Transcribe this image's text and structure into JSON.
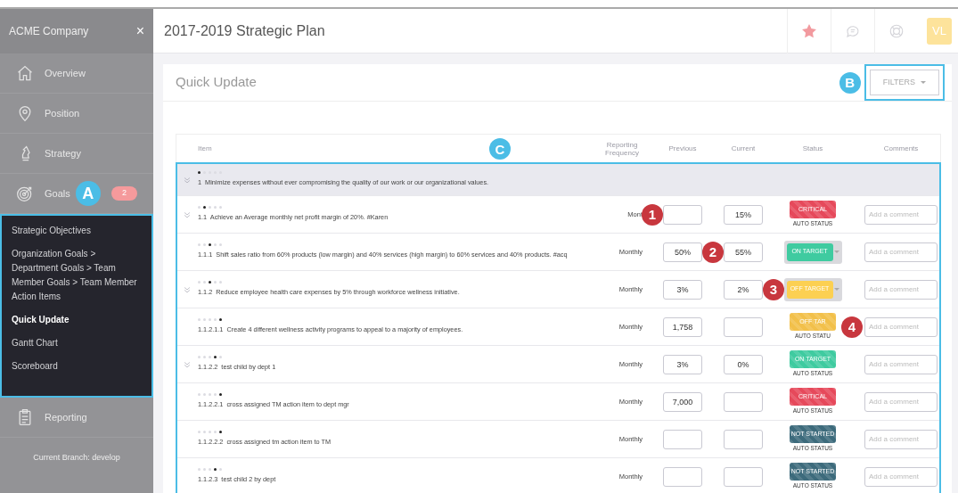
{
  "sidebar": {
    "company": "ACME Company",
    "close": "×",
    "items": [
      {
        "label": "Overview",
        "kind": "home"
      },
      {
        "label": "Position",
        "kind": "pin"
      },
      {
        "label": "Strategy",
        "kind": "pawn"
      },
      {
        "label": "Goals",
        "kind": "target",
        "badge": "2",
        "expanded": true,
        "callout": {
          "label": "A",
          "color": "#4bbde6"
        },
        "children": [
          {
            "label": "Strategic Objectives",
            "selected": false
          },
          {
            "label": "Organization Goals > Department Goals > Team Member Goals > Team Member Action Items",
            "selected": false
          },
          {
            "label": "Quick Update",
            "selected": true
          },
          {
            "label": "Gantt Chart",
            "selected": false
          },
          {
            "label": "Scoreboard",
            "selected": false
          }
        ]
      },
      {
        "label": "Reporting",
        "kind": "clipboard"
      }
    ],
    "footer": "Current Branch: develop"
  },
  "header": {
    "title": "2017-2019 Strategic Plan",
    "actions": [
      {
        "kind": "star"
      },
      {
        "kind": "chat"
      },
      {
        "kind": "lifebuoy"
      }
    ],
    "avatar": "VL"
  },
  "card": {
    "title": "Quick Update",
    "filters": {
      "label": "FILTERS",
      "callout": {
        "label": "B",
        "color": "#4bbde6"
      }
    },
    "table": {
      "columns": [
        "Item",
        "Reporting Frequency",
        "Previous",
        "Current",
        "Status",
        "Comments"
      ],
      "callout": {
        "label": "C",
        "color": "#4bbde6"
      },
      "rows": [
        {
          "text": "1  Minimize expenses without ever compromising the quality of our work or our organizational values.",
          "dots": [
            true,
            false,
            false,
            false,
            false
          ],
          "expandable": true,
          "highlighted": true
        },
        {
          "text": "1.1  Achieve an Average monthly net profit margin of 20%. #Karen",
          "dots": [
            false,
            true,
            false,
            false,
            false
          ],
          "expandable": true,
          "highlighted": false,
          "frequency": "Mont",
          "current": "15%",
          "status": {
            "label": "CRITICAL",
            "kind": "auto",
            "color": "#e6495b",
            "caption": "AUTO STATUS"
          },
          "comment_placeholder": "Add a comment",
          "callout": {
            "label": "1",
            "color": "#c8373e",
            "kind": "frequency"
          }
        },
        {
          "text": "1.1.1  Shift sales ratio from 60% products (low margin) and 40% services (high margin) to 60% services and 40% products. #acq",
          "dots": [
            false,
            false,
            true,
            false,
            false
          ],
          "expandable": false,
          "highlighted": false,
          "frequency": "Monthly",
          "previous": "50%",
          "current": "55%",
          "status": {
            "label": "ON TARGET",
            "kind": "manual",
            "color": "#3fcba0"
          },
          "comment_placeholder": "Add a comment",
          "callout": {
            "label": "2",
            "color": "#c8373e",
            "kind": "previous"
          }
        },
        {
          "text": "1.1.2  Reduce employee health care expenses by 5% through workforce wellness initiative.",
          "dots": [
            false,
            false,
            true,
            false,
            false
          ],
          "expandable": true,
          "highlighted": false,
          "frequency": "Monthly",
          "previous": "3%",
          "current": "2%",
          "status": {
            "label": "OFF TARGET",
            "kind": "manual",
            "color": "#fcd052"
          },
          "comment_placeholder": "Add a comment",
          "callout": {
            "label": "3",
            "color": "#c8373e",
            "kind": "current"
          }
        },
        {
          "text": "1.1.2.1.1  Create 4 different wellness activity programs to appeal to a majority of employees.",
          "dots": [
            false,
            false,
            false,
            false,
            true
          ],
          "expandable": false,
          "highlighted": false,
          "frequency": "Monthly",
          "previous": "1,758",
          "status": {
            "label": "OFF TAR",
            "kind": "auto",
            "color": "#f2c04a",
            "caption": "AUTO STATU"
          },
          "comment_placeholder": "Add a comment",
          "callout": {
            "label": "4",
            "color": "#c8373e",
            "kind": "status"
          }
        },
        {
          "text": "1.1.2.2  test child by dept 1",
          "dots": [
            false,
            false,
            false,
            true,
            false
          ],
          "expandable": true,
          "highlighted": false,
          "frequency": "Monthly",
          "previous": "3%",
          "current": "0%",
          "status": {
            "label": "ON TARGET",
            "kind": "auto",
            "color": "#3fcba0",
            "caption": "AUTO STATUS"
          },
          "comment_placeholder": "Add a comment"
        },
        {
          "text": "1.1.2.2.1  cross assigned TM action item to dept mgr",
          "dots": [
            false,
            false,
            false,
            false,
            true
          ],
          "expandable": false,
          "highlighted": false,
          "frequency": "Monthly",
          "previous": "7,000",
          "status": {
            "label": "CRITICAL",
            "kind": "auto",
            "color": "#e6495b",
            "caption": "AUTO STATUS"
          },
          "comment_placeholder": "Add a comment"
        },
        {
          "text": "1.1.2.2.2  cross assigned tm action item to TM",
          "dots": [
            false,
            false,
            false,
            false,
            true
          ],
          "expandable": false,
          "highlighted": false,
          "frequency": "Monthly",
          "status": {
            "label": "NOT STARTED",
            "kind": "auto",
            "color": "#3d6b7c",
            "caption": "AUTO STATUS"
          },
          "comment_placeholder": "Add a comment"
        },
        {
          "text": "1.1.2.3  test child 2 by dept",
          "dots": [
            false,
            false,
            false,
            true,
            false
          ],
          "expandable": false,
          "highlighted": false,
          "frequency": "Monthly",
          "status": {
            "label": "NOT STARTED",
            "kind": "auto",
            "color": "#3d6b7c",
            "caption": "AUTO STATUS"
          },
          "comment_placeholder": "Add a comment"
        }
      ]
    }
  }
}
